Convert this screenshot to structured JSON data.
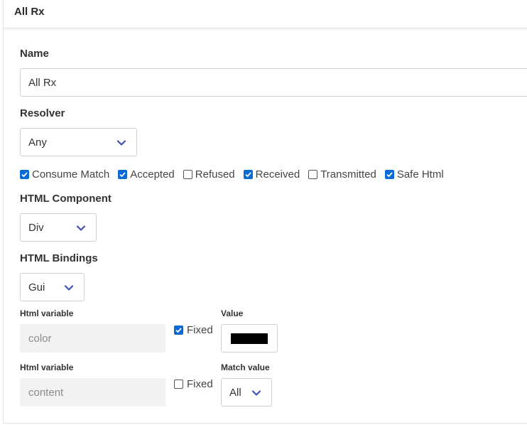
{
  "panel": {
    "title": "All Rx"
  },
  "name": {
    "label": "Name",
    "value": "All Rx"
  },
  "resolver": {
    "label": "Resolver",
    "value": "Any"
  },
  "options": [
    {
      "label": "Consume Match",
      "checked": true
    },
    {
      "label": "Accepted",
      "checked": true
    },
    {
      "label": "Refused",
      "checked": false
    },
    {
      "label": "Received",
      "checked": true
    },
    {
      "label": "Transmitted",
      "checked": false
    },
    {
      "label": "Safe Html",
      "checked": true
    }
  ],
  "html_component": {
    "label": "HTML Component",
    "value": "Div"
  },
  "html_bindings": {
    "label": "HTML Bindings",
    "value": "Gui"
  },
  "binding_rows": [
    {
      "variable_label": "Html variable",
      "variable_placeholder": "color",
      "fixed_label": "Fixed",
      "fixed_checked": true,
      "value_label": "Value",
      "value_color": "#000000"
    },
    {
      "variable_label": "Html variable",
      "variable_placeholder": "content",
      "fixed_label": "Fixed",
      "fixed_checked": false,
      "value_label": "Match value",
      "value_select": "All"
    }
  ],
  "colors": {
    "accent": "#3f51b5",
    "checkbox": "#0b6bd6"
  }
}
